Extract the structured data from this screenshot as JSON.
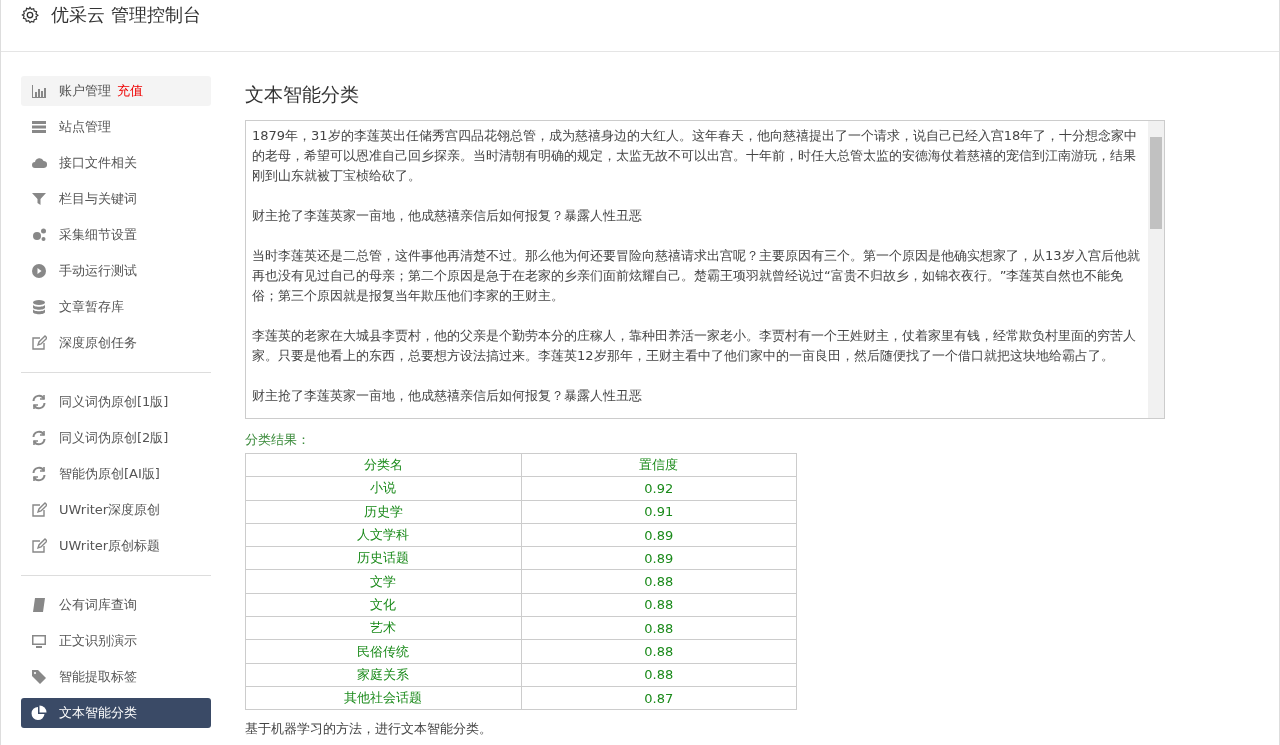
{
  "header": {
    "title": "优采云 管理控制台"
  },
  "sidebar": {
    "groups": [
      {
        "items": [
          {
            "label": "账户管理",
            "badge": "充值",
            "kind": "chart",
            "selected": false
          },
          {
            "label": "站点管理",
            "kind": "server",
            "selected": false
          },
          {
            "label": "接口文件相关",
            "kind": "cloud",
            "selected": false
          },
          {
            "label": "栏目与关键词",
            "kind": "filter",
            "selected": false
          },
          {
            "label": "采集细节设置",
            "kind": "gears",
            "selected": false
          },
          {
            "label": "手动运行测试",
            "kind": "play",
            "selected": false
          },
          {
            "label": "文章暂存库",
            "kind": "database",
            "selected": false
          },
          {
            "label": "深度原创任务",
            "kind": "edit",
            "selected": false
          }
        ]
      },
      {
        "items": [
          {
            "label": "同义词伪原创[1版]",
            "kind": "refresh",
            "selected": false
          },
          {
            "label": "同义词伪原创[2版]",
            "kind": "refresh",
            "selected": false
          },
          {
            "label": "智能伪原创[AI版]",
            "kind": "refresh",
            "selected": false
          },
          {
            "label": "UWriter深度原创",
            "kind": "edit",
            "selected": false
          },
          {
            "label": "UWriter原创标题",
            "kind": "edit",
            "selected": false
          }
        ]
      },
      {
        "items": [
          {
            "label": "公有词库查询",
            "kind": "book",
            "selected": false
          },
          {
            "label": "正文识别演示",
            "kind": "monitor",
            "selected": false
          },
          {
            "label": "智能提取标签",
            "kind": "tag",
            "selected": false
          },
          {
            "label": "文本智能分类",
            "kind": "pie",
            "selected": true
          }
        ]
      }
    ]
  },
  "main": {
    "title": "文本智能分类",
    "article": [
      "1879年，31岁的李莲英出任储秀宫四品花翎总管，成为慈禧身边的大红人。这年春天，他向慈禧提出了一个请求，说自己已经入宫18年了，十分想念家中的老母，希望可以恩准自己回乡探亲。当时清朝有明确的规定，太监无故不可以出宫。十年前，时任大总管太监的安德海仗着慈禧的宠信到江南游玩，结果刚到山东就被丁宝桢给砍了。",
      "财主抢了李莲英家一亩地，他成慈禧亲信后如何报复？暴露人性丑恶",
      "当时李莲英还是二总管，这件事他再清楚不过。那么他为何还要冒险向慈禧请求出宫呢？主要原因有三个。第一个原因是他确实想家了，从13岁入宫后他就再也没有见过自己的母亲；第二个原因是急于在老家的乡亲们面前炫耀自己。楚霸王项羽就曾经说过“富贵不归故乡，如锦衣夜行。”李莲英自然也不能免俗；第三个原因就是报复当年欺压他们李家的王财主。",
      "李莲英的老家在大城县李贾村，他的父亲是个勤劳本分的庄稼人，靠种田养活一家老小。李贾村有一个王姓财主，仗着家里有钱，经常欺负村里面的穷苦人家。只要是他看上的东西，总要想方设法搞过来。李莲英12岁那年，王财主看中了他们家中的一亩良田，然后随便找了一个借口就把这块地给霸占了。",
      "财主抢了李莲英家一亩地，他成慈禧亲信后如何报复？暴露人性丑恶"
    ],
    "result_label": "分类结果：",
    "table": {
      "columns": [
        "分类名",
        "置信度"
      ],
      "rows": [
        [
          "小说",
          "0.92"
        ],
        [
          "历史学",
          "0.91"
        ],
        [
          "人文学科",
          "0.89"
        ],
        [
          "历史话题",
          "0.89"
        ],
        [
          "文学",
          "0.88"
        ],
        [
          "文化",
          "0.88"
        ],
        [
          "艺术",
          "0.88"
        ],
        [
          "民俗传统",
          "0.88"
        ],
        [
          "家庭关系",
          "0.88"
        ],
        [
          "其他社会话题",
          "0.87"
        ]
      ]
    },
    "description": "基于机器学习的方法，进行文本智能分类。"
  }
}
